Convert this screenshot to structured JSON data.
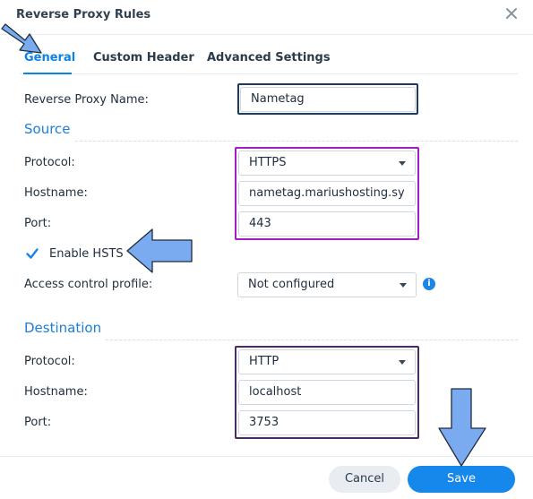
{
  "dialog": {
    "title": "Reverse Proxy Rules"
  },
  "tabs": [
    {
      "label": "General"
    },
    {
      "label": "Custom Header"
    },
    {
      "label": "Advanced Settings"
    }
  ],
  "general": {
    "name_label": "Reverse Proxy Name:",
    "name_value": "Nametag"
  },
  "source": {
    "heading": "Source",
    "protocol_label": "Protocol:",
    "protocol_value": "HTTPS",
    "hostname_label": "Hostname:",
    "hostname_value": "nametag.mariushosting.sy",
    "port_label": "Port:",
    "port_value": "443",
    "hsts_label": "Enable HSTS",
    "hsts_checked": true,
    "acp_label": "Access control profile:",
    "acp_value": "Not configured"
  },
  "destination": {
    "heading": "Destination",
    "protocol_label": "Protocol:",
    "protocol_value": "HTTP",
    "hostname_label": "Hostname:",
    "hostname_value": "localhost",
    "port_label": "Port:",
    "port_value": "3753"
  },
  "footer": {
    "cancel_label": "Cancel",
    "save_label": "Save"
  },
  "colors": {
    "accent": "#1687eb",
    "highlight_purple": "#a11ec2",
    "highlight_dark": "#4a2c63",
    "arrow_fill": "#7aaaf0"
  },
  "icons": {
    "close": "close-icon",
    "dropdown": "chevron-down-icon",
    "info": "info-icon",
    "check": "check-icon",
    "annotation": "arrow-icon"
  }
}
